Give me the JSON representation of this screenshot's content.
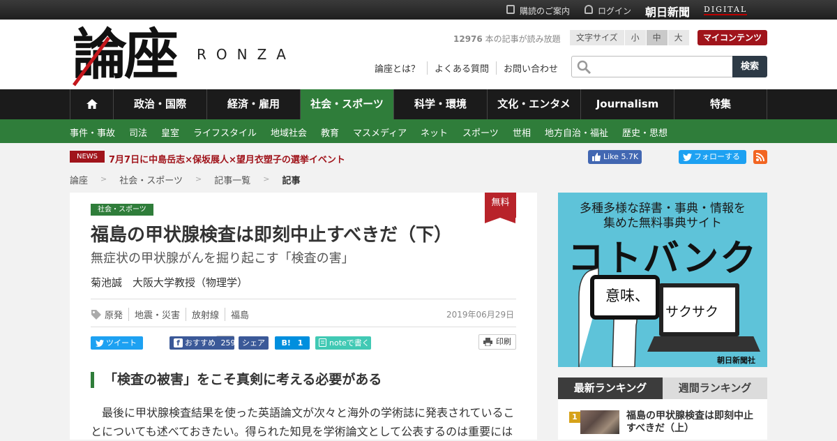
{
  "topbar": {
    "subscribe": "購読のご案内",
    "login": "ログイン",
    "brand_main": "朝日新聞",
    "brand_sub": "DIGITAL"
  },
  "header": {
    "logo_main": "論座",
    "logo_sub": "RONZA",
    "article_count": "12976",
    "article_count_suffix": " 本の記事が読み放題",
    "fontsize_label": "文字サイズ",
    "fontsize_options": [
      "小",
      "中",
      "大"
    ],
    "fontsize_selected": "中",
    "mycontents": "マイコンテンツ",
    "links": [
      "論座とは？",
      "よくある質問",
      "お問い合わせ"
    ],
    "search_placeholder": "",
    "search_button": "検索"
  },
  "nav": {
    "items": [
      "政治・国際",
      "経済・雇用",
      "社会・スポーツ",
      "科学・環境",
      "文化・エンタメ",
      "Journalism",
      "特集"
    ],
    "active": "社会・スポーツ"
  },
  "subnav": {
    "items": [
      "事件・事故",
      "司法",
      "皇室",
      "ライフスタイル",
      "地域社会",
      "教育",
      "マスメディア",
      "ネット",
      "スポーツ",
      "世相",
      "地方自治・福祉",
      "歴史・思想"
    ]
  },
  "news": {
    "label": "NEWS",
    "text": "7月7日に中島岳志×保坂展人×望月衣塑子の選挙イベント"
  },
  "social_top": {
    "like": "Like",
    "like_count": "5.7K",
    "follow": "フォローする"
  },
  "breadcrumb": [
    "論座",
    "社会・スポーツ",
    "記事一覧",
    "記事"
  ],
  "article": {
    "category": "社会・スポーツ",
    "free_badge": "無料",
    "title": "福島の甲状腺検査は即刻中止すべきだ（下）",
    "subtitle": "無症状の甲状腺がんを掘り起こす「検査の害」",
    "author": "菊池誠　大阪大学教授（物理学）",
    "tags": [
      "原発",
      "地震・災害",
      "放射線",
      "福島"
    ],
    "date": "2019年06月29日",
    "share": {
      "tweet": "ツイート",
      "list": "list",
      "recommend": "おすすめ",
      "recommend_count": "259",
      "share": "シェア",
      "hatena": "B!",
      "hatena_count": "1",
      "note": "noteで書く",
      "print": "印刷"
    },
    "section_heading": "「検査の被害」をこそ真剣に考える必要がある",
    "body": "最後に甲状腺検査結果を使った英語論文が次々と海外の学術誌に発表されていることについても述べておきたい。得られた知見を学術論文として公表するのは重要には"
  },
  "ad": {
    "line1": "多種多様な辞書・事典・情報を",
    "line2": "集めた無料事典サイト",
    "brand": "コトバンク",
    "word1": "意味、",
    "word2": "サクサク",
    "credit": "朝日新聞社"
  },
  "ranking": {
    "tabs": [
      "最新ランキング",
      "週間ランキング"
    ],
    "items": [
      {
        "rank": "1",
        "title": "福島の甲状腺検査は即刻中止すべきだ（上）"
      }
    ]
  },
  "colors": {
    "brand_red": "#a0141b",
    "green": "#2f7d3a",
    "nav_bg": "#1b1b1b",
    "ad_bg": "#5ec3d9"
  }
}
